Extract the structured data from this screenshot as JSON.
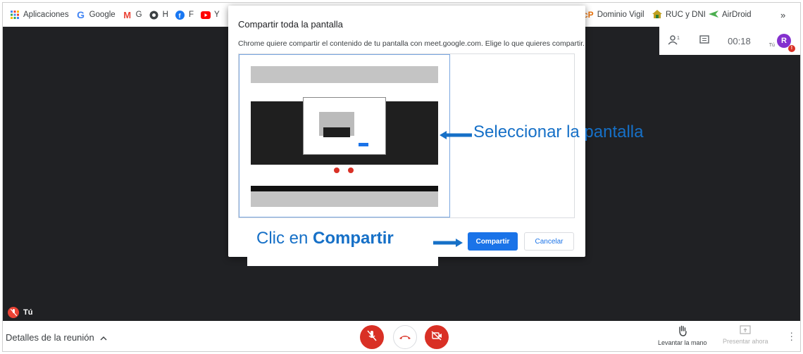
{
  "bookmarks": {
    "left": [
      {
        "icon": "apps-grid-icon",
        "label": "Aplicaciones"
      },
      {
        "icon": "google-icon",
        "label": "Google"
      },
      {
        "icon": "gmail-icon",
        "label": "G"
      },
      {
        "icon": "globe-icon",
        "label": "H"
      },
      {
        "icon": "facebook-icon",
        "label": "F"
      },
      {
        "icon": "youtube-icon",
        "label": "Y"
      }
    ],
    "right": [
      {
        "icon": "cp-icon",
        "label": "Dominio Vigil"
      },
      {
        "icon": "ruc-icon",
        "label": "RUC y DNI"
      },
      {
        "icon": "airdroid-icon",
        "label": "AirDroid"
      }
    ],
    "more": "»"
  },
  "meet": {
    "timer": "00:18",
    "avatar_initial": "R",
    "avatar_label": "Tú",
    "self_label": "Tú",
    "meeting_details": "Detalles de la reunión",
    "raise_hand": "Levantar la mano",
    "present_now": "Presentar ahora"
  },
  "dialog": {
    "title": "Compartir toda la pantalla",
    "subtitle": "Chrome quiere compartir el contenido de tu pantalla con meet.google.com. Elige lo que quieres compartir.",
    "share_label": "Compartir",
    "cancel_label": "Cancelar"
  },
  "annotations": {
    "select_screen": "Seleccionar la pantalla",
    "click_prefix": "Clic en ",
    "click_target": "Compartir"
  },
  "colors": {
    "meet_red": "#d93025",
    "chrome_blue": "#1a73e8",
    "annotation_blue": "#1670c7",
    "stage_bg": "#202124"
  }
}
